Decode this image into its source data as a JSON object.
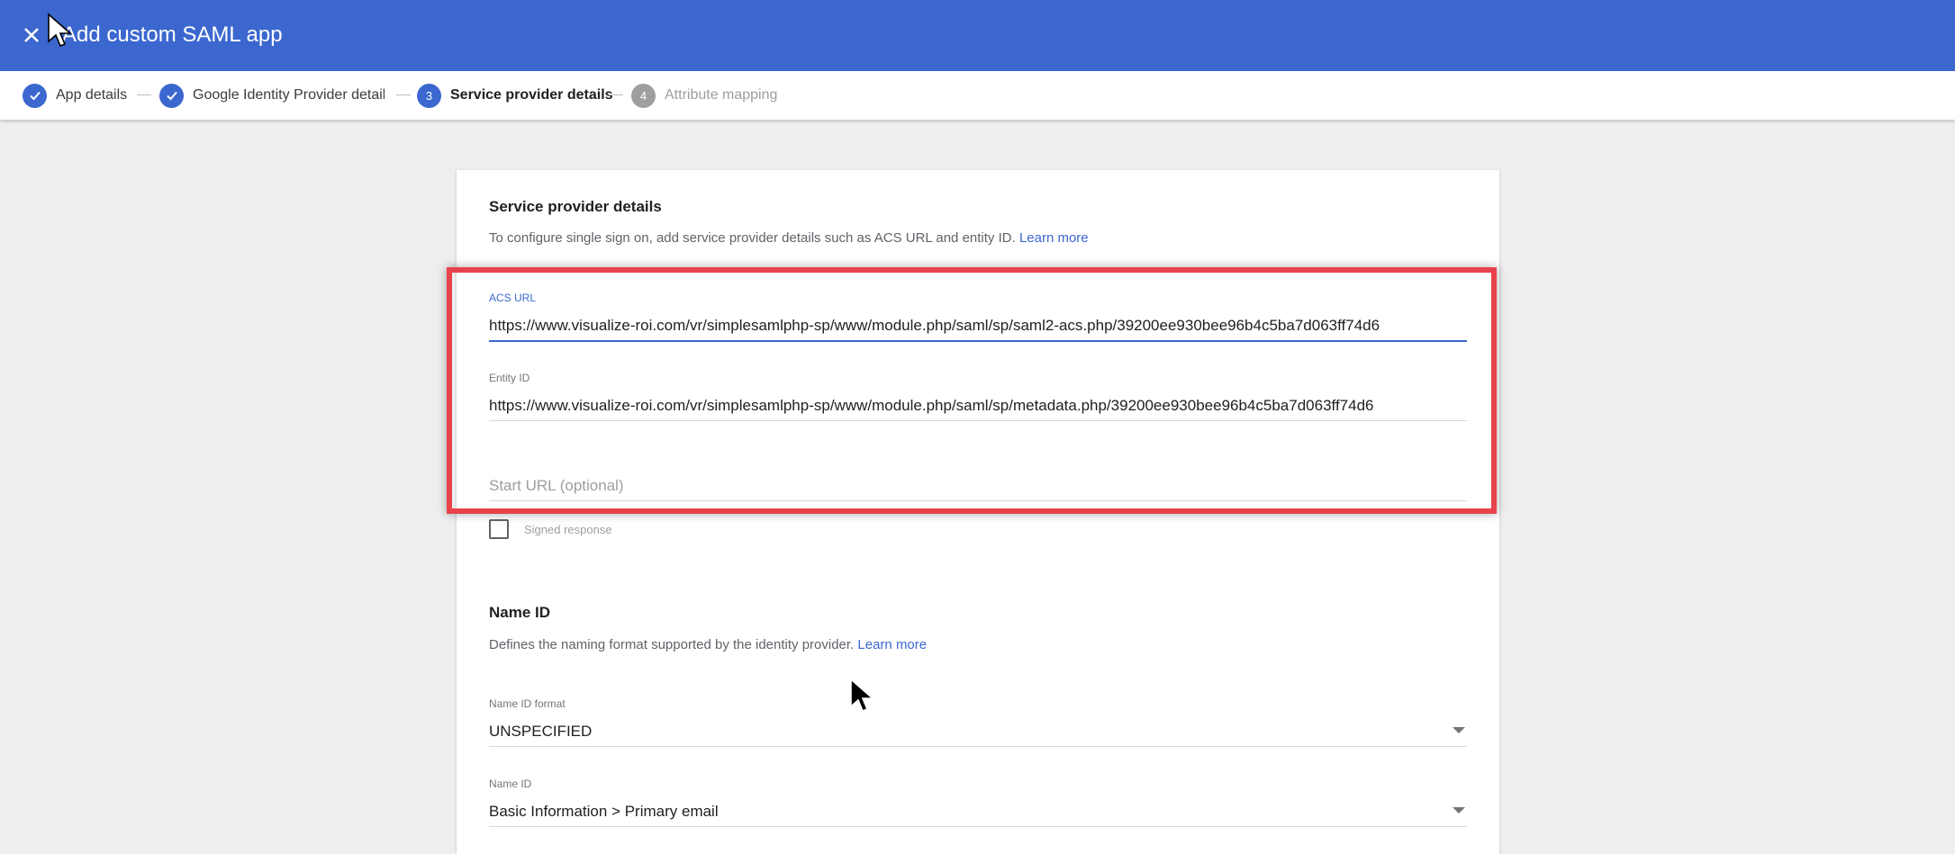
{
  "header": {
    "title": "Add custom SAML app",
    "close_icon": "close-icon"
  },
  "stepper": {
    "steps": [
      {
        "label": "App details",
        "state": "done",
        "number": "1"
      },
      {
        "label": "Google Identity Provider details",
        "state": "done",
        "number": "2"
      },
      {
        "label": "Service provider details",
        "state": "active",
        "number": "3"
      },
      {
        "label": "Attribute mapping",
        "state": "inactive",
        "number": "4"
      }
    ]
  },
  "service_provider": {
    "title": "Service provider details",
    "description": "To configure single sign on, add service provider details such as ACS URL and entity ID.",
    "learn_more": "Learn more",
    "acs_url": {
      "label": "ACS URL",
      "value": "https://www.visualize-roi.com/vr/simplesamlphp-sp/www/module.php/saml/sp/saml2-acs.php/39200ee930bee96b4c5ba7d063ff74d6"
    },
    "entity_id": {
      "label": "Entity ID",
      "value": "https://www.visualize-roi.com/vr/simplesamlphp-sp/www/module.php/saml/sp/metadata.php/39200ee930bee96b4c5ba7d063ff74d6"
    },
    "start_url": {
      "placeholder": "Start URL (optional)"
    },
    "signed_response": {
      "label": "Signed response",
      "checked": false
    }
  },
  "name_id": {
    "title": "Name ID",
    "description": "Defines the naming format supported by the identity provider.",
    "learn_more": "Learn more",
    "format": {
      "label": "Name ID format",
      "value": "UNSPECIFIED"
    },
    "name_id_field": {
      "label": "Name ID",
      "value": "Basic Information > Primary email"
    }
  },
  "colors": {
    "primary": "#3b67cf",
    "highlight": "#e8424a",
    "inactive": "#9e9e9e"
  }
}
